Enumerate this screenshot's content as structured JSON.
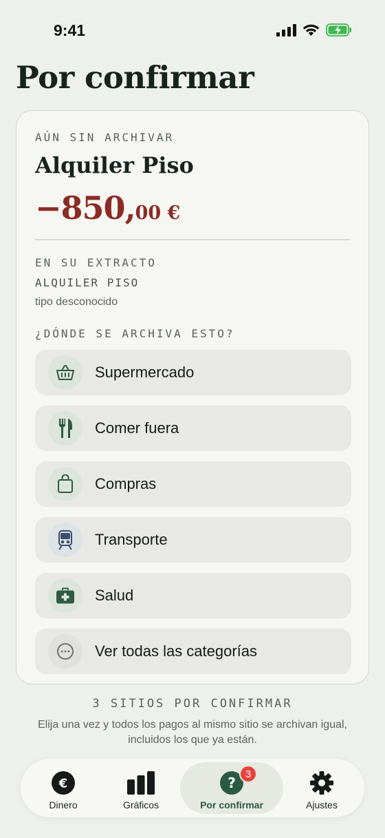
{
  "status": {
    "time": "9:41"
  },
  "page": {
    "title": "Por confirmar"
  },
  "transaction": {
    "eyebrow": "AÚN SIN ARCHIVAR",
    "merchant": "Alquiler Piso",
    "amount_main": "−850,",
    "amount_cents": "00 €",
    "extract_label": "EN SU EXTRACTO",
    "extract_value": "ALQUILER PISO",
    "extract_type": "tipo desconocido"
  },
  "categories": {
    "prompt": "¿DÓNDE SE ARCHIVA ESTO?",
    "items": [
      {
        "label": "Supermercado",
        "icon": "basket-icon",
        "bg": "#dde4dc",
        "fg": "#2e5a45"
      },
      {
        "label": "Comer fuera",
        "icon": "cutlery-icon",
        "bg": "#dde4dc",
        "fg": "#2e5a45"
      },
      {
        "label": "Compras",
        "icon": "shopping-bag-icon",
        "bg": "#dde4dc",
        "fg": "#2e5a45"
      },
      {
        "label": "Transporte",
        "icon": "train-icon",
        "bg": "#dde2e6",
        "fg": "#3a4d6b"
      },
      {
        "label": "Salud",
        "icon": "first-aid-icon",
        "bg": "#dde4dc",
        "fg": "#2e5a45"
      },
      {
        "label": "Ver todas las categorías",
        "icon": "more-icon",
        "bg": "#e0e1dc",
        "fg": "#6b716d"
      }
    ]
  },
  "footer": {
    "count": "3 SITIOS POR CONFIRMAR",
    "description": "Elija una vez y todos los pagos al mismo sitio se archivan igual, incluidos los que ya están."
  },
  "tabs": [
    {
      "label": "Dinero",
      "icon": "euro-icon"
    },
    {
      "label": "Gráficos",
      "icon": "bar-chart-icon"
    },
    {
      "label": "Por confirmar",
      "icon": "question-icon",
      "active": true,
      "badge": "3"
    },
    {
      "label": "Ajustes",
      "icon": "gear-icon"
    }
  ],
  "colors": {
    "accent": "#2b5a44",
    "amount": "#8b2b26",
    "badge": "#e8423d"
  }
}
